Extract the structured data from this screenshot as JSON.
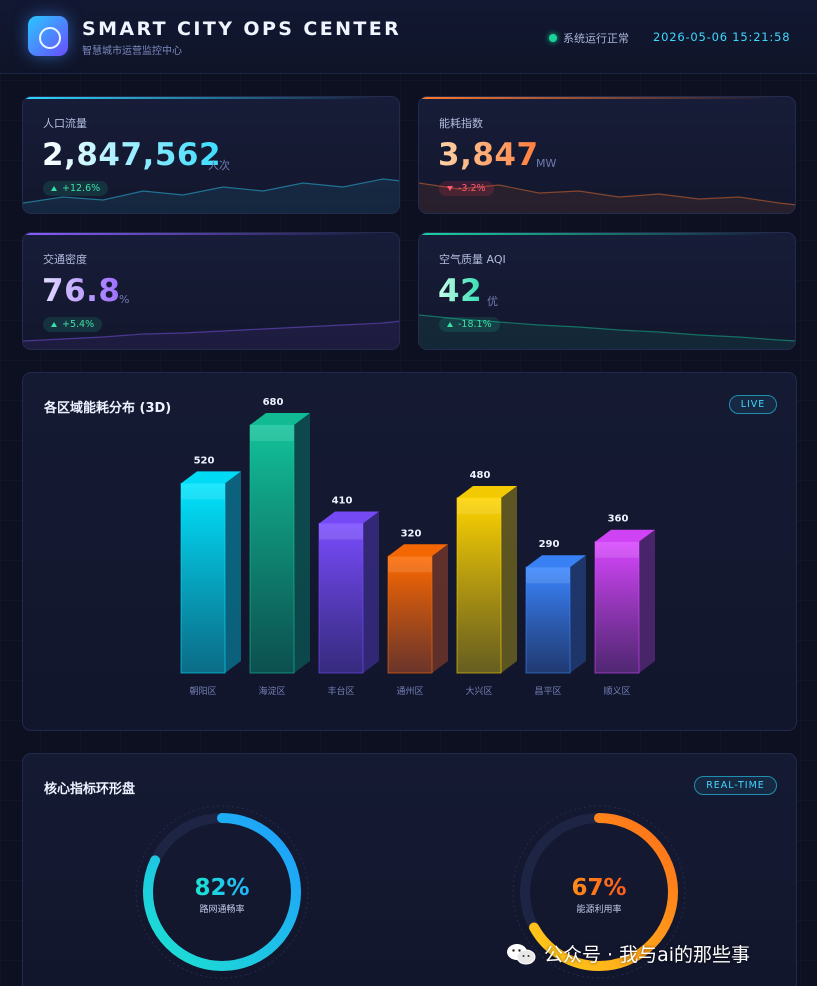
{
  "header": {
    "title": "SMART CITY OPS CENTER",
    "subtitle": "智慧城市运营监控中心",
    "status_text": "系统运行正常",
    "datetime": "2026-05-06 15:21:58"
  },
  "kpis": [
    {
      "label": "人口流量",
      "value": "2,847,562",
      "unit": "人次",
      "change": "+12.6%",
      "direction": "up",
      "accent": "#2fd8ff",
      "value_gradient": [
        "#ffffff",
        "#39dcff"
      ]
    },
    {
      "label": "能耗指数",
      "value": "3,847",
      "unit": "MW",
      "change": "-3.2%",
      "direction": "down",
      "accent": "#ff7a2e",
      "value_gradient": [
        "#ffd2a8",
        "#ff7d3a"
      ]
    },
    {
      "label": "交通密度",
      "value": "76.8",
      "unit": "%",
      "change": "+5.4%",
      "direction": "up",
      "accent": "#8a5cff",
      "value_gradient": [
        "#e4dcff",
        "#9b6cff"
      ]
    },
    {
      "label": "空气质量 AQI",
      "value": "42",
      "unit": "优",
      "change": "-18.1%",
      "direction": "up",
      "accent": "#19d4a0",
      "value_gradient": [
        "#c8ffe9",
        "#2fdcb0"
      ]
    }
  ],
  "bar_panel": {
    "title": "各区域能耗分布 (3D)",
    "tag": "LIVE"
  },
  "ring_panel": {
    "title": "核心指标环形盘",
    "tag": "REAL-TIME",
    "rings": [
      {
        "value_text": "82%",
        "label": "路网通畅率",
        "fraction": 0.82,
        "colors": [
          "#1de3d0",
          "#1e9bff"
        ]
      },
      {
        "value_text": "67%",
        "label": "能源利用率",
        "fraction": 0.67,
        "colors": [
          "#ffd21a",
          "#ff6a1a"
        ]
      }
    ]
  },
  "chart_data": {
    "type": "bar",
    "categories": [
      "朝阳区",
      "海淀区",
      "丰台区",
      "通州区",
      "大兴区",
      "昌平区",
      "顺义区"
    ],
    "values": [
      520,
      680,
      410,
      320,
      480,
      290,
      360
    ],
    "colors": [
      [
        "#00e5ff",
        "#0a7b97"
      ],
      [
        "#12c39a",
        "#0b5a55"
      ],
      [
        "#7a4cff",
        "#3c2e8c"
      ],
      [
        "#ff6a00",
        "#7a3a2a"
      ],
      [
        "#ffd400",
        "#756a1e"
      ],
      [
        "#3a86ff",
        "#23407e"
      ],
      [
        "#d946ff",
        "#5b2a7e"
      ]
    ],
    "ylim": [
      0,
      680
    ]
  },
  "watermark": "公众号 · 我与ai的那些事"
}
